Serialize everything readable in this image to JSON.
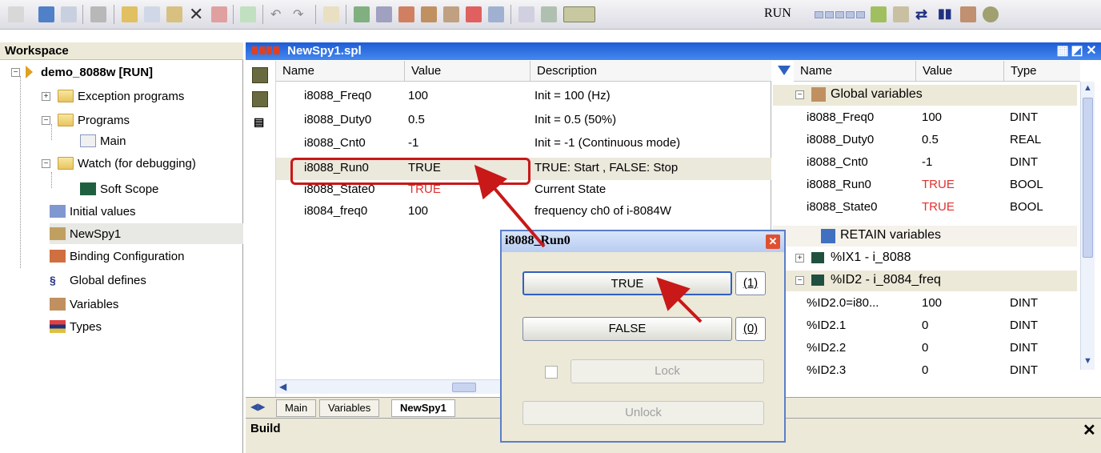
{
  "toolbar": {
    "run_label": "RUN"
  },
  "workspace": {
    "title": "Workspace",
    "project": "demo_8088w [RUN]",
    "items": [
      {
        "label": "Exception programs"
      },
      {
        "label": "Programs"
      },
      {
        "label": "Main"
      },
      {
        "label": "Watch (for debugging)"
      },
      {
        "label": "Soft Scope"
      },
      {
        "label": "Initial values"
      },
      {
        "label": "NewSpy1"
      },
      {
        "label": "Binding Configuration"
      },
      {
        "label": "Global defines"
      },
      {
        "label": "Variables"
      },
      {
        "label": "Types"
      }
    ]
  },
  "spy": {
    "title": "NewSpy1.spl",
    "columns": {
      "name": "Name",
      "value": "Value",
      "description": "Description"
    },
    "rows": [
      {
        "name": "i8088_Freq0",
        "value": "100",
        "description": "Init = 100 (Hz)"
      },
      {
        "name": "i8088_Duty0",
        "value": "0.5",
        "description": "Init = 0.5 (50%)"
      },
      {
        "name": "i8088_Cnt0",
        "value": "-1",
        "description": "Init = -1 (Continuous mode)"
      },
      {
        "name": "i8088_Run0",
        "value": "TRUE",
        "description": "TRUE: Start , FALSE: Stop"
      },
      {
        "name": "i8088_State0",
        "value": "TRUE",
        "description": "Current State"
      },
      {
        "name": "i8084_freq0",
        "value": "100",
        "description": "frequency ch0 of i-8084W"
      }
    ]
  },
  "right": {
    "columns": {
      "name": "Name",
      "value": "Value",
      "type": "Type"
    },
    "global_label": "Global variables",
    "globals": [
      {
        "name": "i8088_Freq0",
        "value": "100",
        "type": "DINT"
      },
      {
        "name": "i8088_Duty0",
        "value": "0.5",
        "type": "REAL"
      },
      {
        "name": "i8088_Cnt0",
        "value": "-1",
        "type": "DINT"
      },
      {
        "name": "i8088_Run0",
        "value": "TRUE",
        "type": "BOOL"
      },
      {
        "name": "i8088_State0",
        "value": "TRUE",
        "type": "BOOL"
      }
    ],
    "retain_label": "RETAIN variables",
    "ix1_label": "%IX1 - i_8088",
    "id2_label": "%ID2 - i_8084_freq",
    "id2_rows": [
      {
        "name": "%ID2.0=i80...",
        "value": "100",
        "type": "DINT"
      },
      {
        "name": "%ID2.1",
        "value": "0",
        "type": "DINT"
      },
      {
        "name": "%ID2.2",
        "value": "0",
        "type": "DINT"
      },
      {
        "name": "%ID2.3",
        "value": "0",
        "type": "DINT"
      }
    ]
  },
  "tabs": [
    {
      "label": "Main"
    },
    {
      "label": "Variables"
    },
    {
      "label": "NewSpy1"
    }
  ],
  "build": {
    "label": "Build"
  },
  "dialog": {
    "title": "i8088_Run0",
    "true_label": "TRUE",
    "true_key": "(1)",
    "false_label": "FALSE",
    "false_key": "(0)",
    "lock_label": "Lock",
    "unlock_label": "Unlock"
  }
}
